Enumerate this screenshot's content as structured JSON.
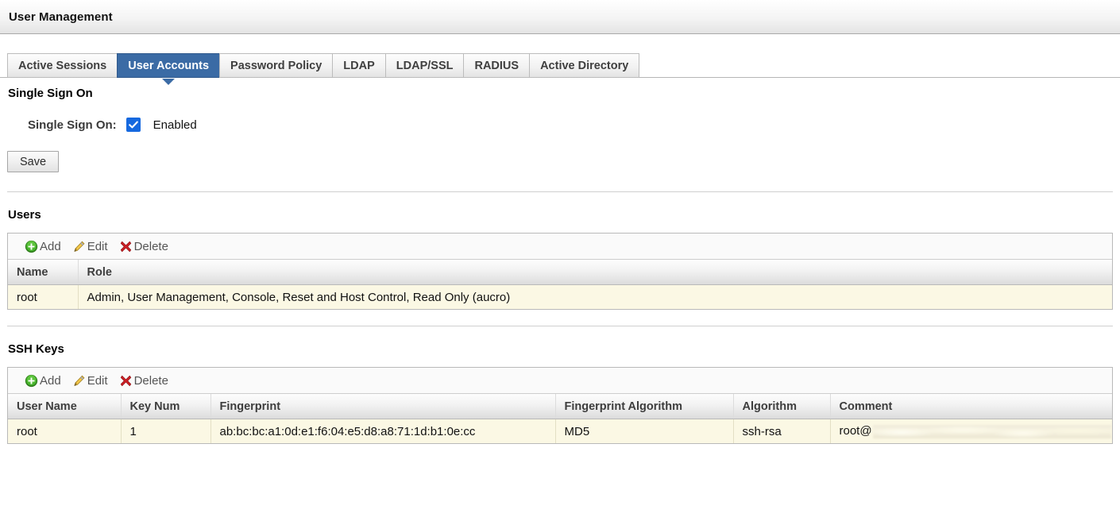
{
  "header": {
    "title": "User Management"
  },
  "tabs": [
    {
      "label": "Active Sessions",
      "active": false
    },
    {
      "label": "User Accounts",
      "active": true
    },
    {
      "label": "Password Policy",
      "active": false
    },
    {
      "label": "LDAP",
      "active": false
    },
    {
      "label": "LDAP/SSL",
      "active": false
    },
    {
      "label": "RADIUS",
      "active": false
    },
    {
      "label": "Active Directory",
      "active": false
    }
  ],
  "single_sign_on": {
    "section_title": "Single Sign On",
    "field_label": "Single Sign On:",
    "checked": true,
    "state_text": "Enabled",
    "save_label": "Save"
  },
  "users": {
    "section_title": "Users",
    "toolbar": {
      "add_label": "Add",
      "edit_label": "Edit",
      "delete_label": "Delete"
    },
    "columns": [
      "Name",
      "Role"
    ],
    "rows": [
      {
        "name": "root",
        "role": "Admin, User Management, Console, Reset and Host Control, Read Only (aucro)"
      }
    ]
  },
  "ssh_keys": {
    "section_title": "SSH Keys",
    "toolbar": {
      "add_label": "Add",
      "edit_label": "Edit",
      "delete_label": "Delete"
    },
    "columns": [
      "User Name",
      "Key Num",
      "Fingerprint",
      "Fingerprint Algorithm",
      "Algorithm",
      "Comment"
    ],
    "rows": [
      {
        "user_name": "root",
        "key_num": "1",
        "fingerprint": "ab:bc:bc:a1:0d:e1:f6:04:e5:d8:a8:71:1d:b1:0e:cc",
        "fingerprint_algorithm": "MD5",
        "algorithm": "ssh-rsa",
        "comment": "root@"
      }
    ]
  },
  "colors": {
    "active_tab": "#3b6ba5",
    "checkbox": "#1669df",
    "row_selected": "#fbf8e4",
    "add_icon": "#3a9b24",
    "edit_icon": "#e8b33c",
    "delete_icon": "#cc2222"
  }
}
